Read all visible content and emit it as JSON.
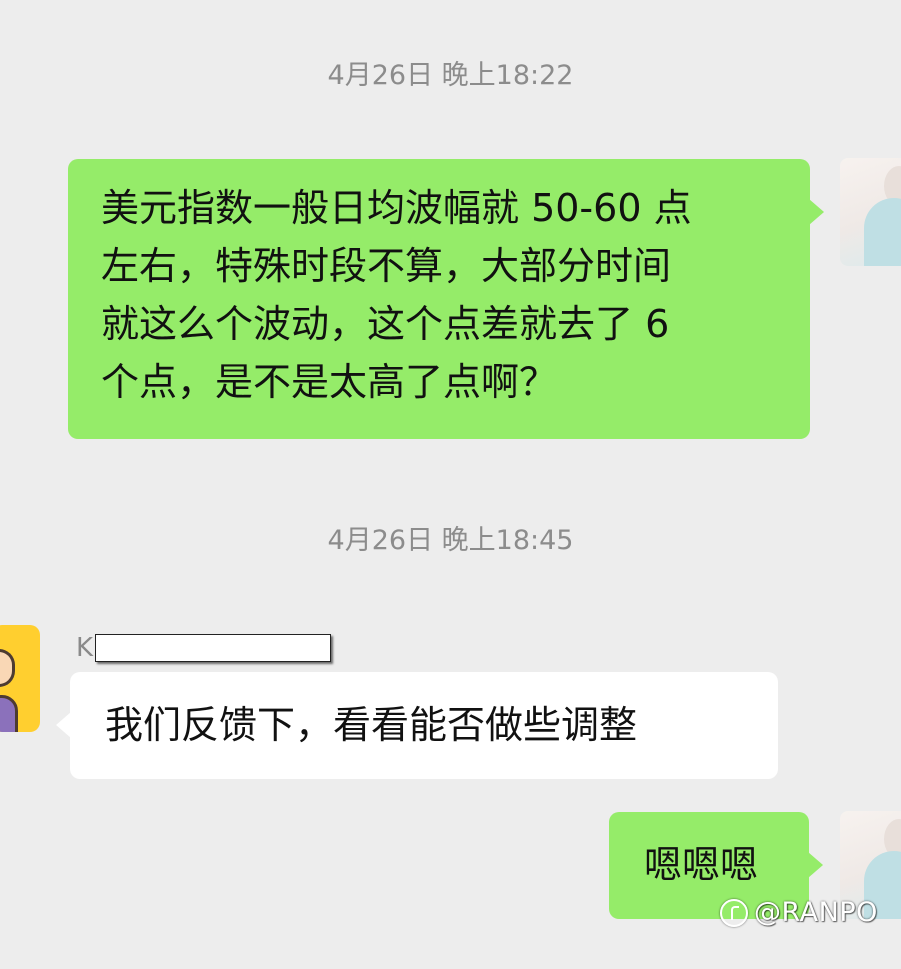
{
  "chat": {
    "timestamps": [
      "4月26日 晚上18:22",
      "4月26日 晚上18:45"
    ],
    "messages": [
      {
        "direction": "sent",
        "lines": [
          "美元指数一般日均波幅就 50-60 点",
          "左右，特殊时段不算，大部分时间",
          "就这么个波动，这个点差就去了 6",
          "个点，是不是太高了点啊？"
        ]
      },
      {
        "direction": "received",
        "sender_initial": "K",
        "text": "我们反馈下，看看能否做些调整"
      },
      {
        "direction": "sent",
        "text": "嗯嗯嗯"
      }
    ]
  },
  "watermark": {
    "text": "@RANPO",
    "icon": "zhihu-logo-icon"
  },
  "colors": {
    "background": "#ededed",
    "sent_bubble": "#95ec69",
    "received_bubble": "#ffffff",
    "timestamp_text": "#8c8c8c"
  }
}
